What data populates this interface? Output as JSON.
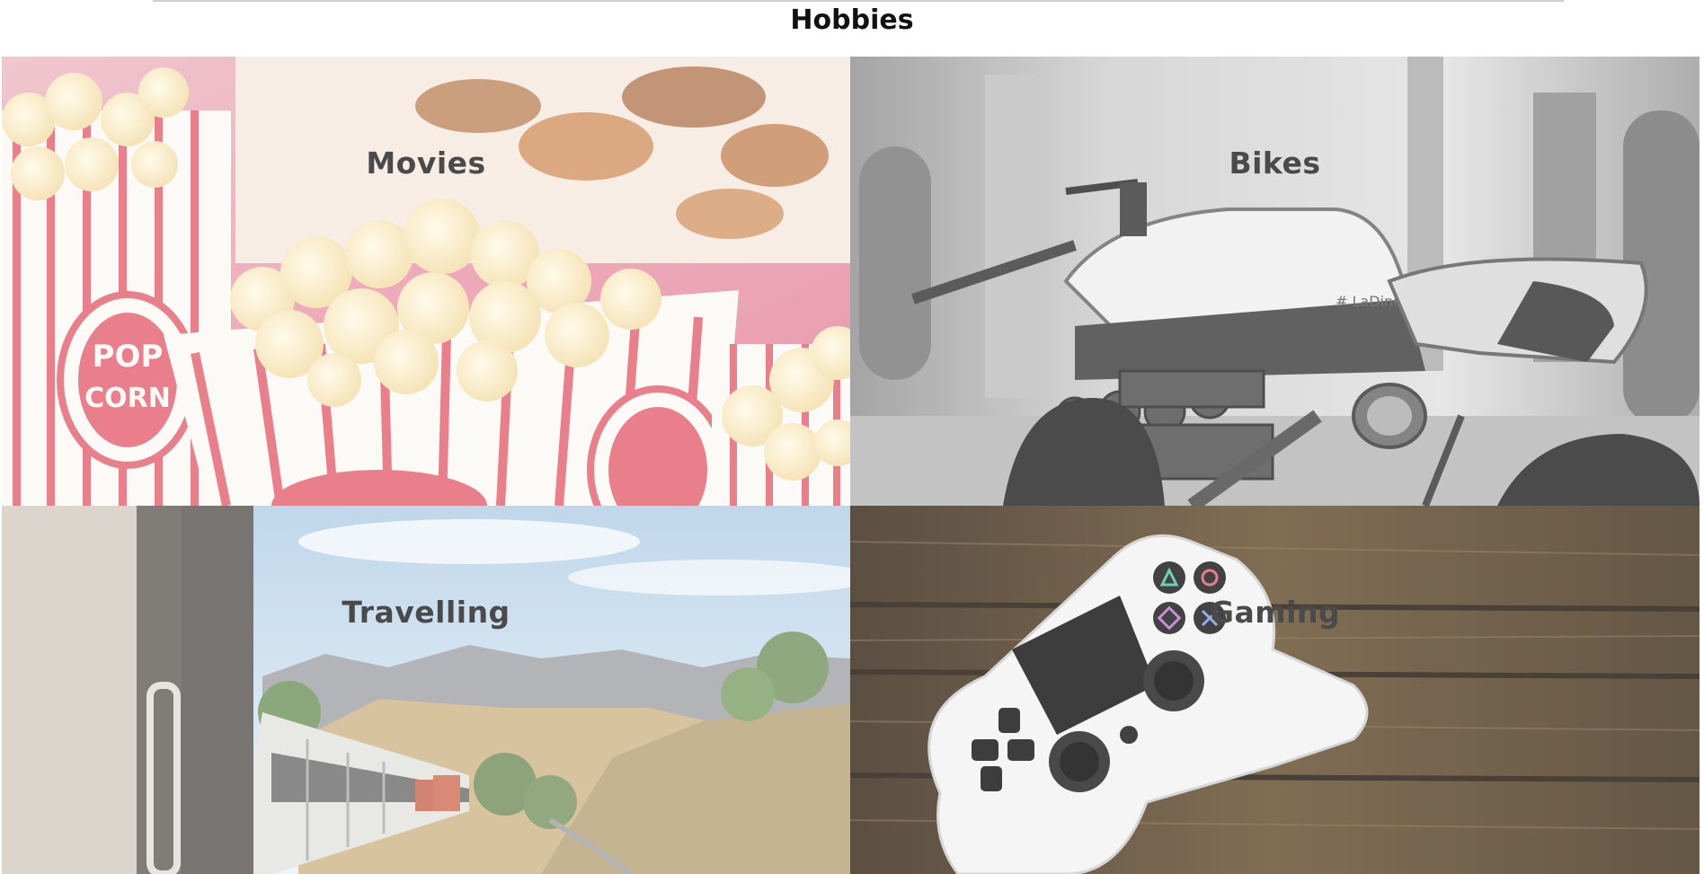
{
  "page": {
    "title": "Hobbies"
  },
  "tiles": [
    {
      "label": "Movies",
      "image": "popcorn-photo"
    },
    {
      "label": "Bikes",
      "image": "motorcycle-photo"
    },
    {
      "label": "Travelling",
      "image": "train-landscape-photo"
    },
    {
      "label": "Gaming",
      "image": "game-controller-photo"
    }
  ],
  "decor": {
    "popcorn_box": "POP CORN",
    "bike_tank_brand": "# LaDini"
  }
}
